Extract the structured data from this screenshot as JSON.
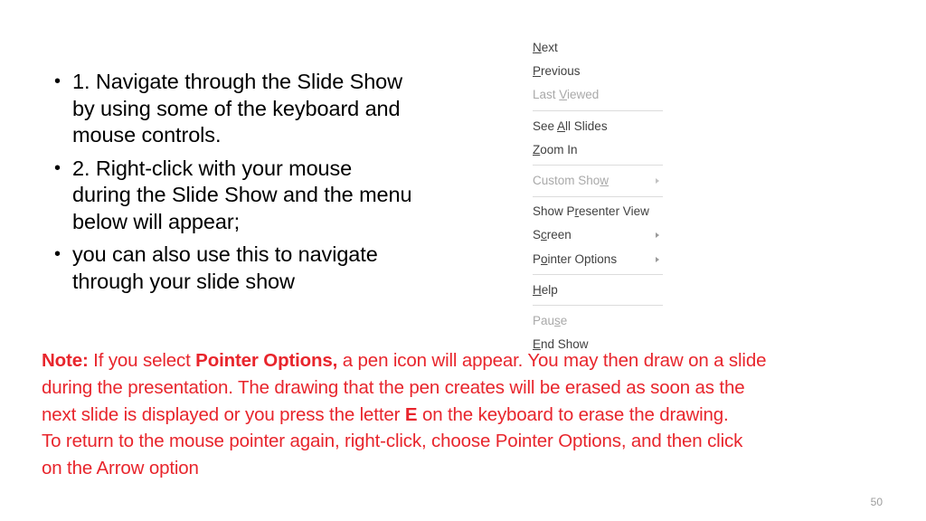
{
  "slide": {
    "number": "50",
    "background_color": "#ffffff"
  },
  "colors": {
    "body_text": "#000000",
    "note_red": "#E8252C",
    "menu_text": "#404040",
    "menu_disabled": "#a9a9a9",
    "menu_separator": "#dcdcdc",
    "slide_number": "#9c9c9c"
  },
  "bullets": [
    {
      "glyph": "•",
      "text": "1. Navigate through the Slide Show by using some of the keyboard and mouse controls."
    },
    {
      "glyph": "•",
      "text": "2. Right-click with your mouse during the Slide Show and the menu below will appear;"
    },
    {
      "glyph": "•",
      "text": "you can also use this to navigate through your slide show"
    }
  ],
  "context_menu": {
    "items": [
      {
        "label": "Next",
        "accel_index": 0,
        "disabled": false,
        "submenu": false,
        "separator_after": false
      },
      {
        "label": "Previous",
        "accel_index": 0,
        "disabled": false,
        "submenu": false,
        "separator_after": false
      },
      {
        "label": "Last Viewed",
        "accel_index": 5,
        "disabled": true,
        "submenu": false,
        "separator_after": true
      },
      {
        "label": "See All Slides",
        "accel_index": 4,
        "disabled": false,
        "submenu": false,
        "separator_after": false
      },
      {
        "label": "Zoom In",
        "accel_index": 0,
        "disabled": false,
        "submenu": false,
        "separator_after": true
      },
      {
        "label": "Custom Show",
        "accel_index": 10,
        "disabled": true,
        "submenu": true,
        "separator_after": true
      },
      {
        "label": "Show Presenter View",
        "accel_index": 6,
        "disabled": false,
        "submenu": false,
        "separator_after": false
      },
      {
        "label": "Screen",
        "accel_index": 1,
        "disabled": false,
        "submenu": true,
        "separator_after": false
      },
      {
        "label": "Pointer Options",
        "accel_index": 1,
        "disabled": false,
        "submenu": true,
        "separator_after": true
      },
      {
        "label": "Help",
        "accel_index": 0,
        "disabled": false,
        "submenu": false,
        "separator_after": true
      },
      {
        "label": "Pause",
        "accel_index": 3,
        "disabled": true,
        "submenu": false,
        "separator_after": false
      },
      {
        "label": "End Show",
        "accel_index": 0,
        "disabled": false,
        "submenu": false,
        "separator_after": false
      }
    ]
  },
  "note": {
    "lines": [
      [
        {
          "text": "Note:",
          "bold": true
        },
        {
          "text": " If you select ",
          "bold": false
        },
        {
          "text": "Pointer Options,",
          "bold": true
        },
        {
          "text": " a pen icon will appear. You may then draw on a slide",
          "bold": false
        }
      ],
      [
        {
          "text": "during the presentation. The drawing that the pen creates will be erased as soon as the",
          "bold": false
        }
      ],
      [
        {
          "text": "next slide is displayed or you press the letter ",
          "bold": false
        },
        {
          "text": "E",
          "bold": true
        },
        {
          "text": " on the keyboard to erase the drawing.",
          "bold": false
        }
      ],
      [
        {
          "text": "To return to the mouse pointer again, right-click, choose Pointer Options, and then click",
          "bold": false
        }
      ],
      [
        {
          "text": "on the Arrow option",
          "bold": false
        }
      ]
    ]
  }
}
